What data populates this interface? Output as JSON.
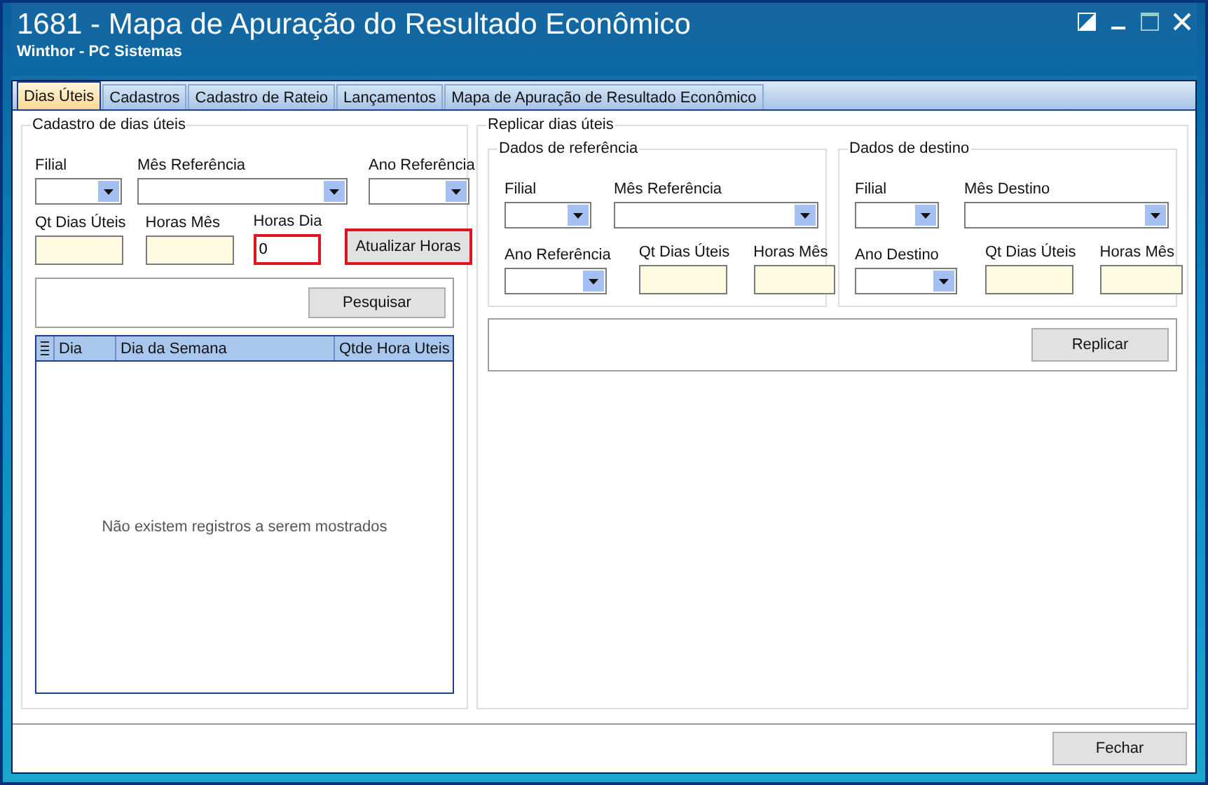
{
  "window": {
    "title": "1681 - Mapa de Apuração do Resultado Econômico",
    "subtitle": "Winthor - PC Sistemas"
  },
  "tabs": [
    {
      "label": "Dias Úteis",
      "selected": true
    },
    {
      "label": "Cadastros",
      "selected": false
    },
    {
      "label": "Cadastro de Rateio",
      "selected": false
    },
    {
      "label": "Lançamentos",
      "selected": false
    },
    {
      "label": "Mapa de Apuração de Resultado Econômico",
      "selected": false
    }
  ],
  "left_panel": {
    "title": "Cadastro de dias úteis",
    "rows": [
      [
        {
          "label": "Filial",
          "kind": "combo",
          "highlighted": false
        },
        {
          "label": "Mês Referência",
          "kind": "combo",
          "highlighted": false
        },
        {
          "label": "Ano Referência",
          "kind": "combo",
          "highlighted": false
        }
      ],
      [
        {
          "label": "Qt Dias Úteis",
          "kind": "readonly",
          "highlighted": false
        },
        {
          "label": "Horas Mês",
          "kind": "readonly",
          "highlighted": false
        },
        {
          "label": "Horas Dia",
          "kind": "input",
          "value": "0",
          "highlighted": true
        }
      ]
    ],
    "update_button": {
      "label": "Atualizar Horas",
      "highlighted": true
    },
    "search_button": {
      "label": "Pesquisar"
    },
    "table": {
      "columns": [
        "Dia",
        "Dia da Semana",
        "Qtde Hora Uteis"
      ],
      "empty_message": "Não existem registros a serem mostrados"
    }
  },
  "right_panel": {
    "title": "Replicar dias úteis",
    "groups": [
      {
        "title": "Dados de referência",
        "rows": [
          [
            {
              "label": "Filial",
              "kind": "combo"
            },
            {
              "label": "Mês Referência",
              "kind": "combo"
            }
          ],
          [
            {
              "label": "Ano Referência",
              "kind": "combo"
            },
            {
              "label": "Qt Dias Úteis",
              "kind": "readonly"
            },
            {
              "label": "Horas Mês",
              "kind": "readonly"
            }
          ]
        ]
      },
      {
        "title": "Dados de destino",
        "rows": [
          [
            {
              "label": "Filial",
              "kind": "combo"
            },
            {
              "label": "Mês Destino",
              "kind": "combo"
            }
          ],
          [
            {
              "label": "Ano Destino",
              "kind": "combo"
            },
            {
              "label": "Qt Dias Úteis",
              "kind": "readonly"
            },
            {
              "label": "Horas Mês",
              "kind": "readonly"
            }
          ]
        ]
      }
    ],
    "replicate_button": {
      "label": "Replicar"
    }
  },
  "footer": {
    "close_button": {
      "label": "Fechar"
    }
  }
}
